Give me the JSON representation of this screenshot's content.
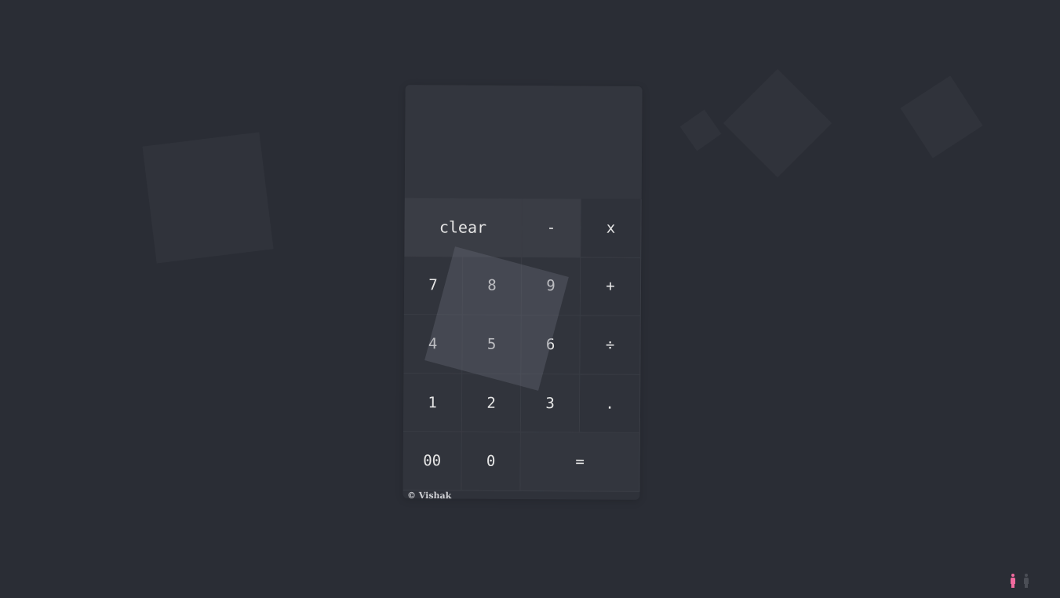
{
  "display": {
    "value": ""
  },
  "keys": {
    "clear": "clear",
    "minus": "-",
    "multiply": "x",
    "seven": "7",
    "eight": "8",
    "nine": "9",
    "plus": "+",
    "four": "4",
    "five": "5",
    "six": "6",
    "divide": "÷",
    "one": "1",
    "two": "2",
    "three": "3",
    "dot": ".",
    "double_zero": "00",
    "zero": "0",
    "equals": "="
  },
  "footer": {
    "credit": "© Vishak"
  },
  "corner": {
    "female_icon": "female-person-icon",
    "male_icon": "male-person-icon",
    "female_color": "#f06a9e",
    "male_color": "#4b4e56"
  },
  "colors": {
    "background": "#2a2d35",
    "calculator": "#2f323a",
    "text": "#e6e6e6"
  }
}
